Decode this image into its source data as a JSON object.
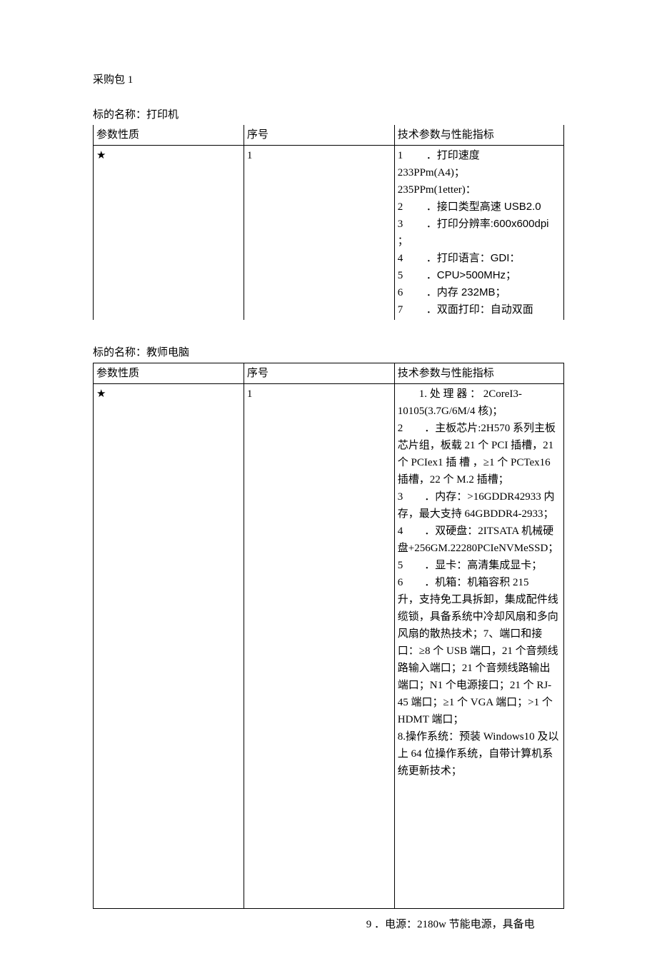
{
  "page_label": "采购包 1",
  "headers": {
    "param_nature": "参数性质",
    "seq_no": "序号",
    "tech_spec": "技术参数与性能指标"
  },
  "subjects": [
    {
      "label_prefix": "标的名称：",
      "name": "打印机",
      "nature": "★",
      "seq": "1",
      "spec_lines": [
        {
          "n": "1",
          "dot": "．",
          "t": "打印速度"
        },
        {
          "plain": "233PPm(A4)；"
        },
        {
          "plain": "235PPm(1etter)："
        },
        {
          "n": "2",
          "dot": "．",
          "t": "接口类型高速 USB2.0"
        },
        {
          "n": "3",
          "dot": "．",
          "t": "打印分辨率:600x600dpi"
        },
        {
          "plain": "；"
        },
        {
          "n": "4",
          "dot": "．",
          "t": "打印语言：GDI："
        },
        {
          "n": "5",
          "dot": "．",
          "t": "CPU>500MHz；"
        },
        {
          "n": "6",
          "dot": "．",
          "t": "内存 232MB；"
        },
        {
          "n": "7",
          "dot": "．",
          "t": "双面打印：自动双面"
        }
      ]
    },
    {
      "label_prefix": "标的名称：",
      "name": "教师电脑",
      "nature": "★",
      "seq": "1",
      "spec_text": "　　1. 处 理 器 ： 2CoreI3-10105(3.7G/6M/4 核)；\n2　　．主板芯片:2H570 系列主板芯片组，板载 21 个 PCI 插槽，21 个 PCIex1 插 槽 ，≥1 个 PCTex16 插槽，22 个 M.2 插槽；\n3　　．内存：>16GDDR42933 内存，最大支持 64GBDDR4-2933；\n4　　．双硬盘：2ITSATA 机械硬盘+256GM.22280PCIeNVMeSSD；\n5　　．显卡：高清集成显卡；\n6　　．机箱：机箱容积 215\n升，支持免工具拆卸，集成配件线缆锁，具备系统中冷却风扇和多向风扇的散热技术；7、端口和接口：≥8 个 USB 端口，21 个音频线路输入端口；21 个音频线路输出端口；N1 个电源接口；21 个 RJ-45 端口；≥1 个 VGA 端口；>1 个 HDMT 端口；\n8.操作系统：预装 Windows10 及以上 64 位操作系统，自带计算机系统更新技术；"
    }
  ],
  "after_note": "9 ．电源：2180w 节能电源，具备电"
}
